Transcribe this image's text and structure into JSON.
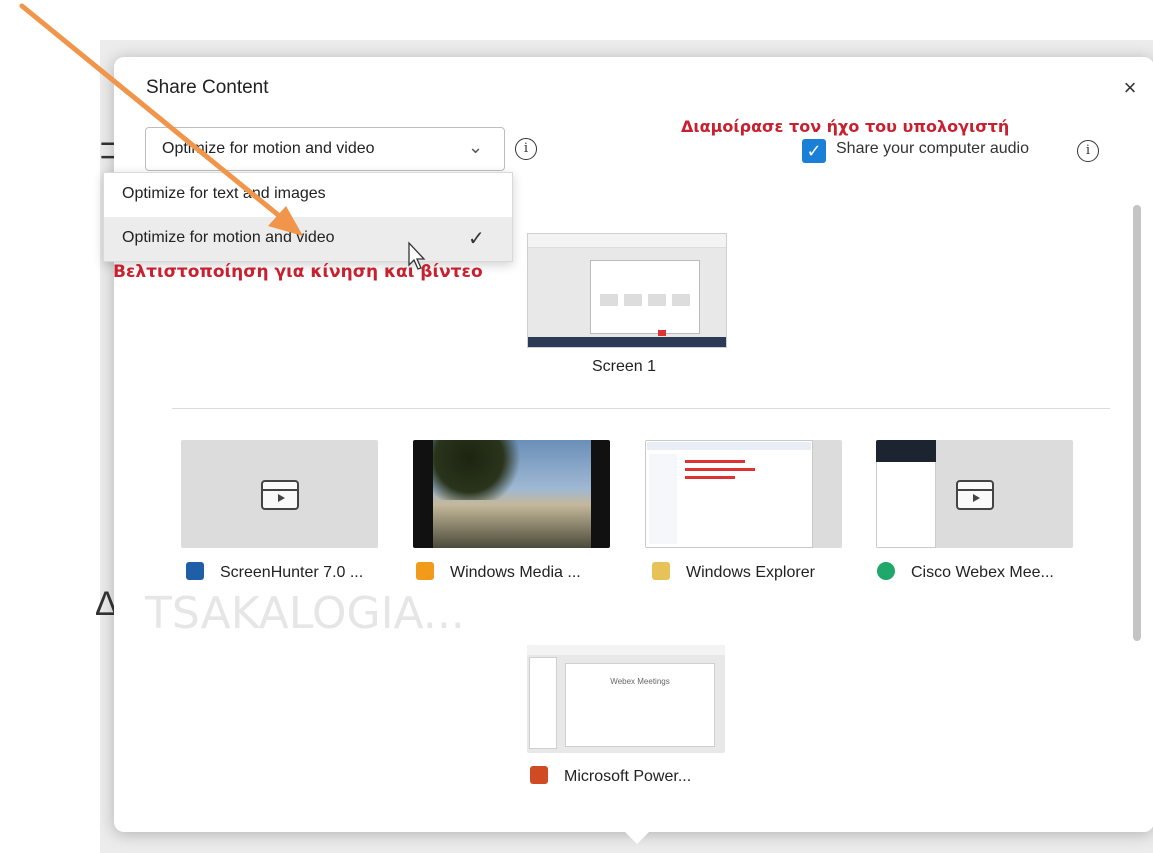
{
  "dialog": {
    "title": "Share Content",
    "close_glyph": "×"
  },
  "optimize": {
    "selected": "Optimize for motion and video",
    "options": [
      {
        "label": "Optimize for text and images"
      },
      {
        "label": "Optimize for motion and video"
      }
    ],
    "check_glyph": "✓"
  },
  "audio": {
    "label": "Share your computer audio",
    "checked_glyph": "✓"
  },
  "annotations": {
    "audio": "Διαμοίρασε τον ήχο του υπολογιστή",
    "motion": "Βελτιστοποίηση για κίνηση και βίντεο"
  },
  "screens": [
    {
      "label": "Screen 1"
    }
  ],
  "apps": [
    {
      "label": "ScreenHunter 7.0 ...",
      "icon": "screenhunter-icon"
    },
    {
      "label": "Windows Media ...",
      "icon": "windows-media-icon"
    },
    {
      "label": "Windows Explorer",
      "icon": "windows-explorer-icon"
    },
    {
      "label": "Cisco Webex Mee...",
      "icon": "webex-icon"
    },
    {
      "label": "Microsoft Power...",
      "icon": "powerpoint-icon"
    }
  ],
  "ppt_preview_title": "Webex Meetings",
  "background": {
    "ghost_text": "TSAKALOGIA...",
    "glyph_top": "⊃",
    "glyph_bottom": "Δ"
  },
  "colors": {
    "accent": "#1a7fd6",
    "annotation": "#c8202f",
    "arrow": "#f0954a"
  }
}
